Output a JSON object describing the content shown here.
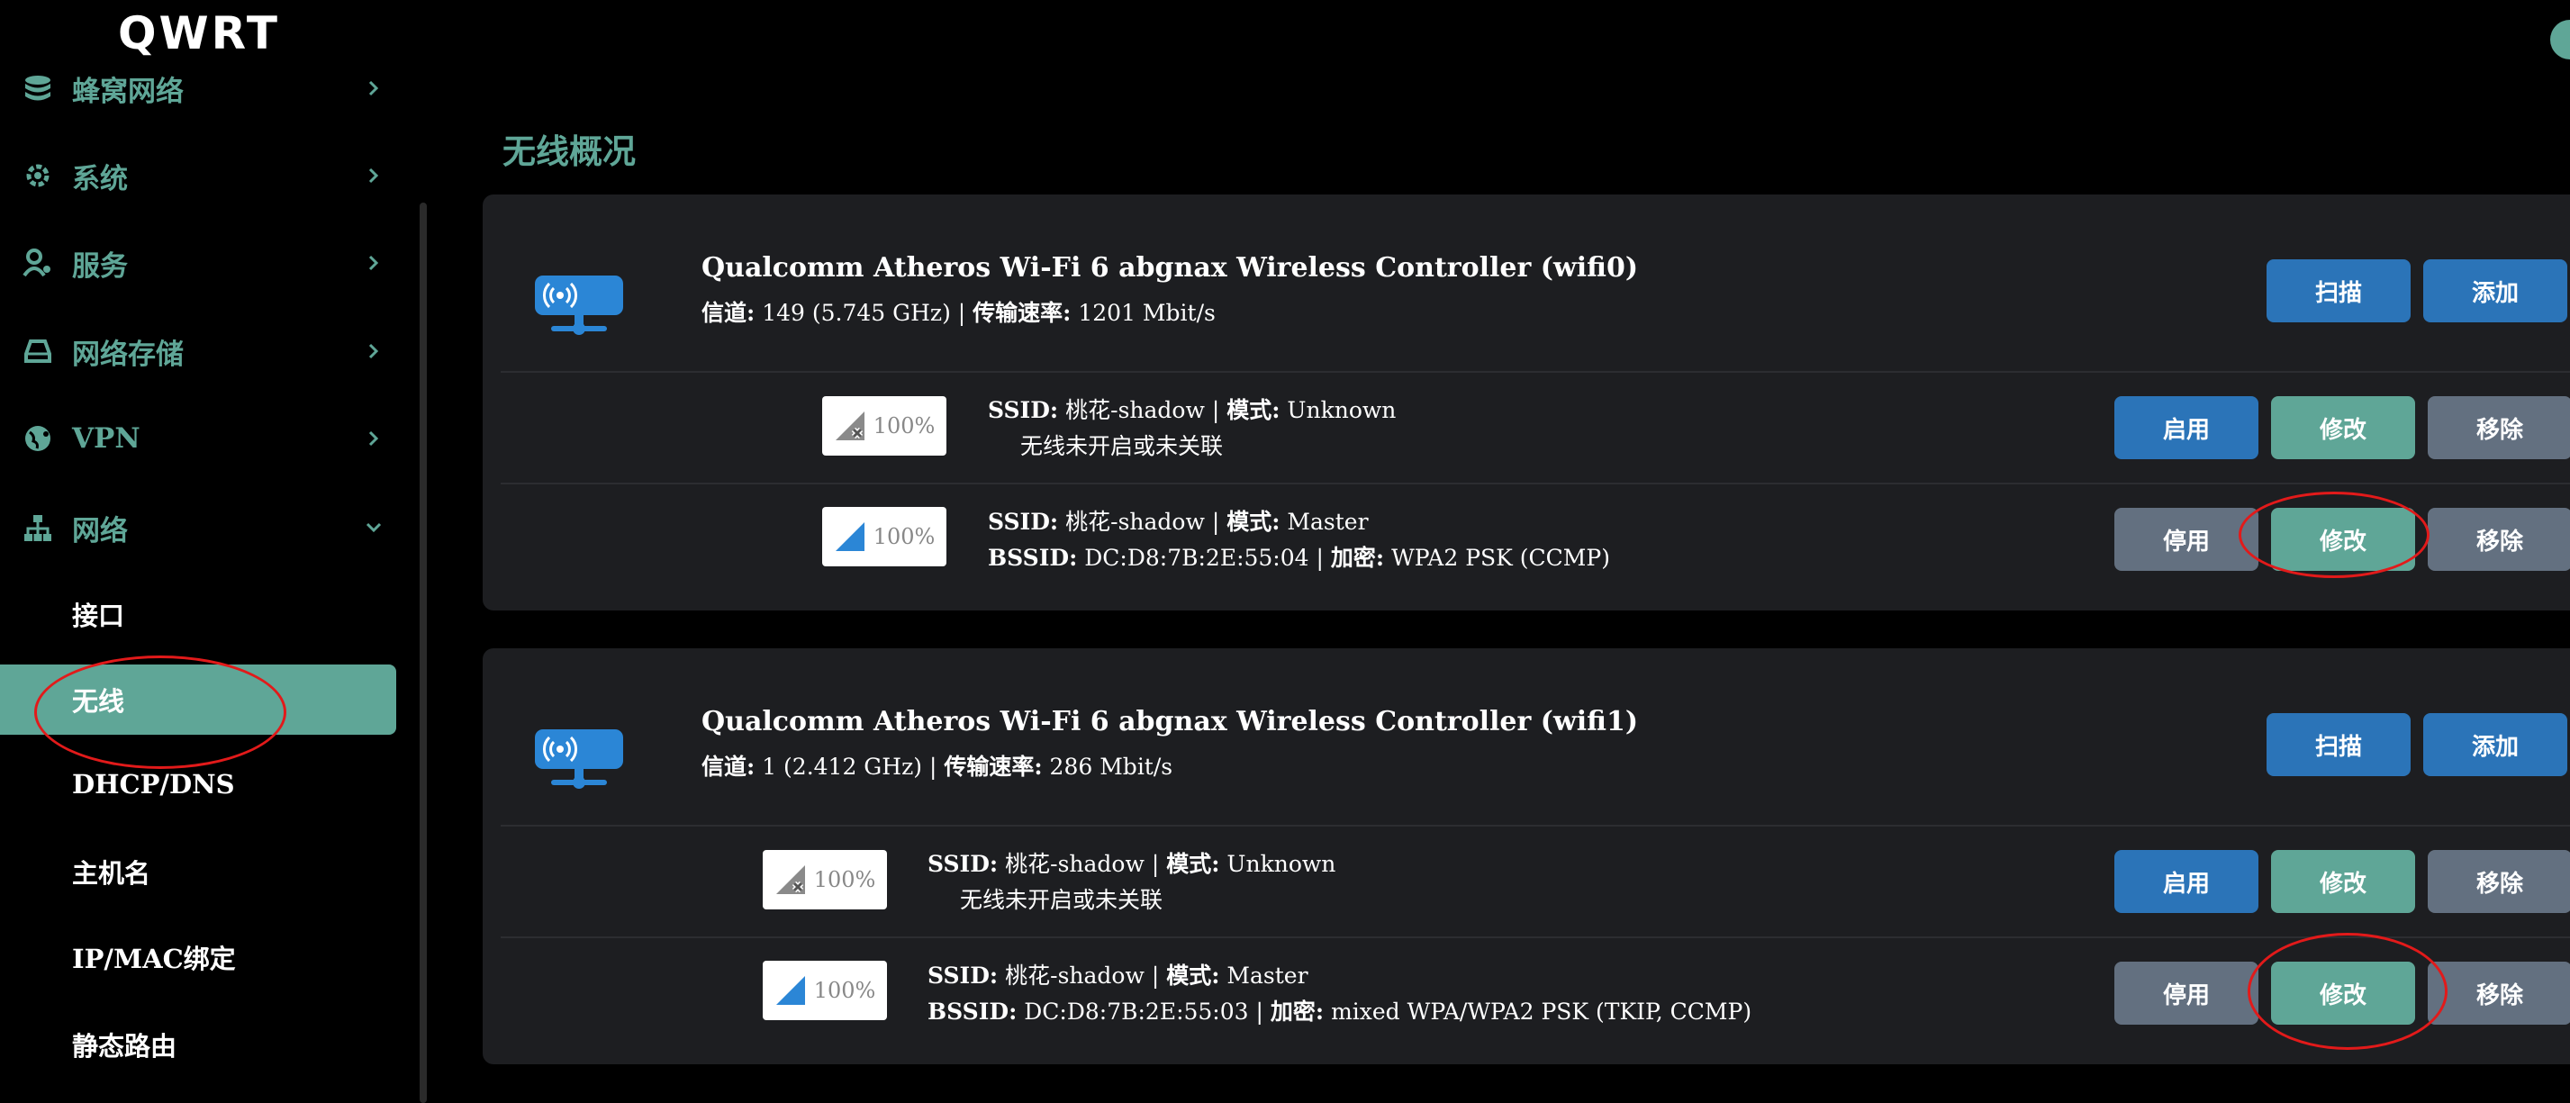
{
  "app": {
    "logo": "QWRT"
  },
  "colors": {
    "accent": "#5fa697",
    "primary": "#2b74b8",
    "secondary": "#637080",
    "card": "#1d1e21"
  },
  "sidebar": {
    "items": [
      {
        "label": "蜂窝网络",
        "icon": "database-icon"
      },
      {
        "label": "系统",
        "icon": "gear-icon"
      },
      {
        "label": "服务",
        "icon": "user-gear-icon"
      },
      {
        "label": "网络存储",
        "icon": "hdd-icon"
      },
      {
        "label": "VPN",
        "icon": "globe-icon"
      },
      {
        "label": "网络",
        "icon": "network-icon"
      }
    ],
    "sub_items": [
      "接口",
      "无线",
      "DHCP/DNS",
      "主机名",
      "IP/MAC绑定",
      "静态路由"
    ],
    "active": "无线"
  },
  "page": {
    "title": "无线概况"
  },
  "labels": {
    "channel": "信道:",
    "rate": "传输速率:",
    "ssid": "SSID:",
    "mode": "模式:",
    "bssid": "BSSID:",
    "encryption": "加密:",
    "sep": "|"
  },
  "buttons": {
    "scan": "扫描",
    "add": "添加",
    "enable": "启用",
    "disable": "停用",
    "edit": "修改",
    "remove": "移除"
  },
  "devices": [
    {
      "name": "Qualcomm Atheros Wi-Fi 6 abgnax Wireless Controller (wifi0)",
      "channel": "149 (5.745 GHz)",
      "rate": "1201 Mbit/s",
      "networks": [
        {
          "signal": "100%",
          "ssid": "桃花-shadow",
          "mode": "Unknown",
          "status": "无线未开启或未关联",
          "toggle": "启用"
        },
        {
          "signal": "100%",
          "ssid": "桃花-shadow",
          "mode": "Master",
          "bssid": "DC:D8:7B:2E:55:04",
          "encryption": "WPA2 PSK (CCMP)",
          "toggle": "停用"
        }
      ]
    },
    {
      "name": "Qualcomm Atheros Wi-Fi 6 abgnax Wireless Controller (wifi1)",
      "channel": "1 (2.412 GHz)",
      "rate": "286 Mbit/s",
      "networks": [
        {
          "signal": "100%",
          "ssid": "桃花-shadow",
          "mode": "Unknown",
          "status": "无线未开启或未关联",
          "toggle": "启用"
        },
        {
          "signal": "100%",
          "ssid": "桃花-shadow",
          "mode": "Master",
          "bssid": "DC:D8:7B:2E:55:03",
          "encryption": "mixed WPA/WPA2 PSK (TKIP, CCMP)",
          "toggle": "停用"
        }
      ]
    }
  ]
}
